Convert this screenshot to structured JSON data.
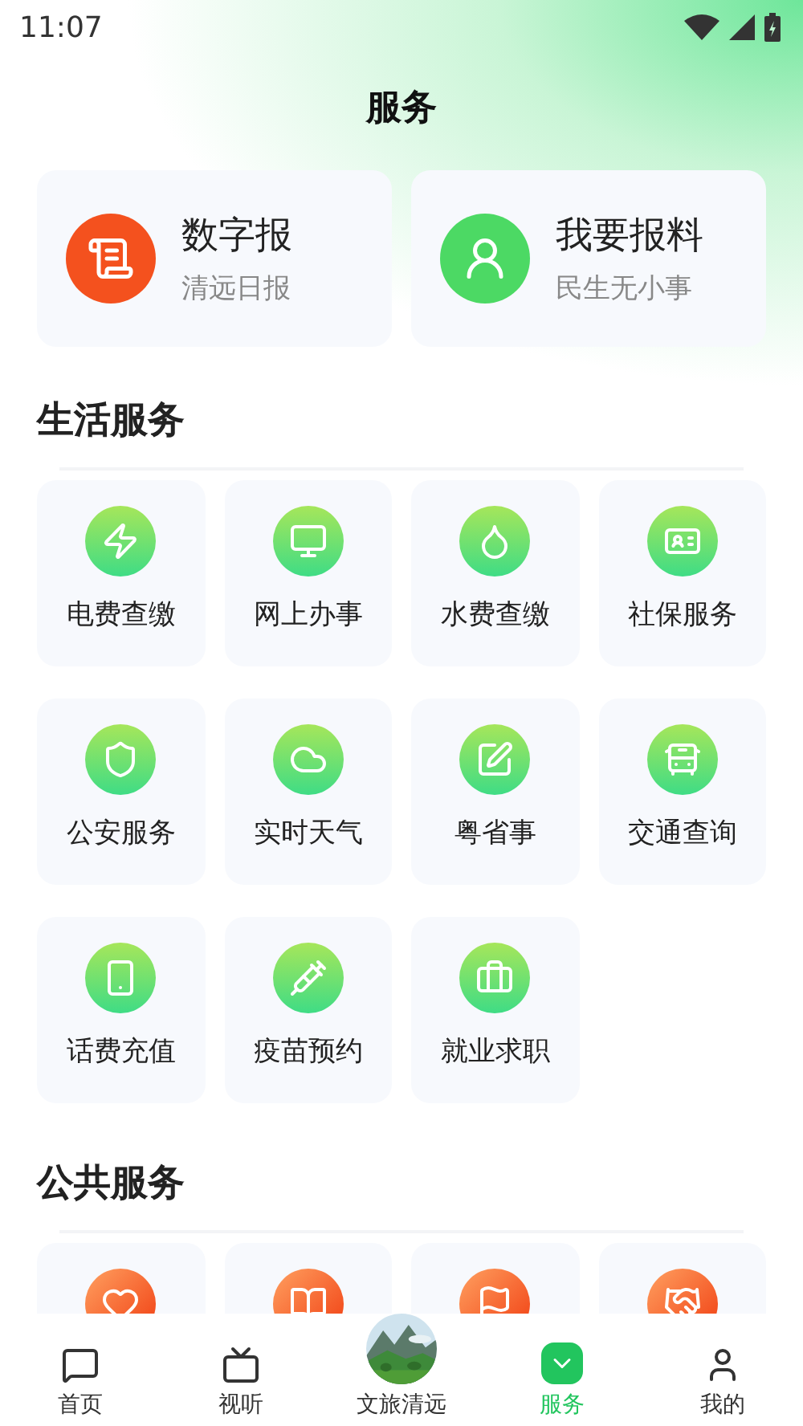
{
  "status_bar": {
    "time": "11:07"
  },
  "header": {
    "title": "服务"
  },
  "featured": [
    {
      "title": "数字报",
      "subtitle": "清远日报",
      "color": "#f4511e"
    },
    {
      "title": "我要报料",
      "subtitle": "民生无小事",
      "color": "#4cd964"
    }
  ],
  "life_services": {
    "title": "生活服务",
    "items": [
      {
        "label": "电费查缴"
      },
      {
        "label": "网上办事"
      },
      {
        "label": "水费查缴"
      },
      {
        "label": "社保服务"
      },
      {
        "label": "公安服务"
      },
      {
        "label": "实时天气"
      },
      {
        "label": "粤省事"
      },
      {
        "label": "交通查询"
      },
      {
        "label": "话费充值"
      },
      {
        "label": "疫苗预约"
      },
      {
        "label": "就业求职"
      }
    ]
  },
  "public_services": {
    "title": "公共服务"
  },
  "bottom_nav": [
    {
      "label": "首页",
      "selected": false,
      "kind": "icon"
    },
    {
      "label": "视听",
      "selected": false,
      "kind": "icon"
    },
    {
      "label": "文旅清远",
      "selected": false,
      "kind": "picture"
    },
    {
      "label": "服务",
      "selected": true,
      "kind": "icon"
    },
    {
      "label": "我的",
      "selected": false,
      "kind": "icon"
    }
  ]
}
